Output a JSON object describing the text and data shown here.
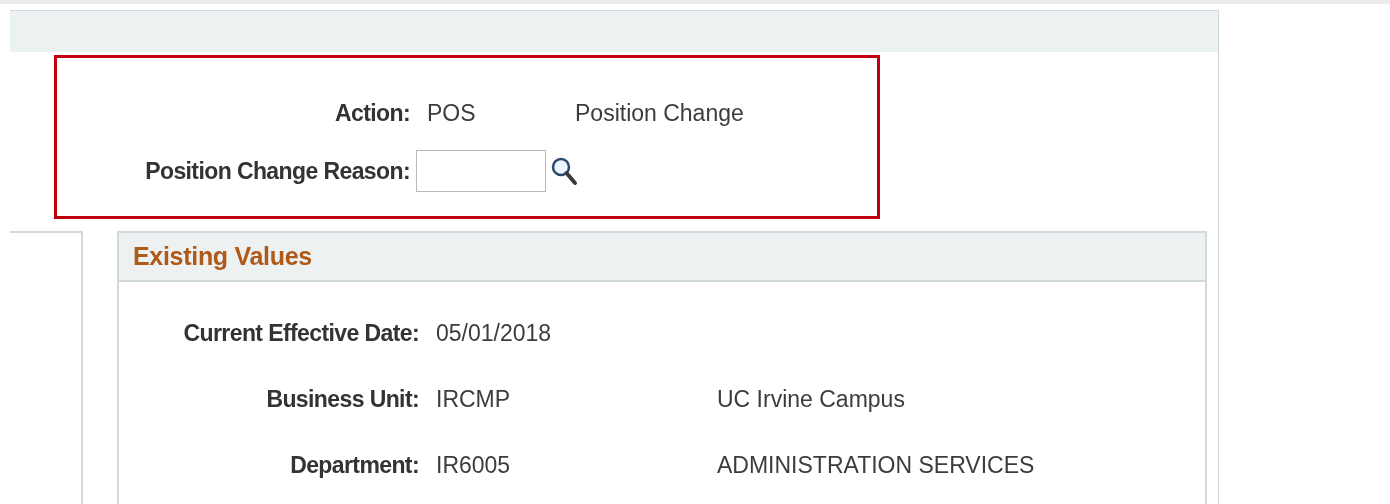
{
  "action_box": {
    "fields": [
      {
        "kind": "text",
        "label": "Action:",
        "value": "POS",
        "description": "Position Change"
      },
      {
        "kind": "lookup",
        "label": "Position Change Reason:"
      }
    ]
  },
  "existing_values": {
    "title": "Existing Values",
    "fields": [
      {
        "label": "Current Effective Date:",
        "value": "05/01/2018"
      },
      {
        "label": "Business Unit:",
        "value": "IRCMP",
        "description": "UC Irvine Campus"
      },
      {
        "label": "Department:",
        "value": "IR6005",
        "description": "ADMINISTRATION SERVICES"
      }
    ]
  }
}
